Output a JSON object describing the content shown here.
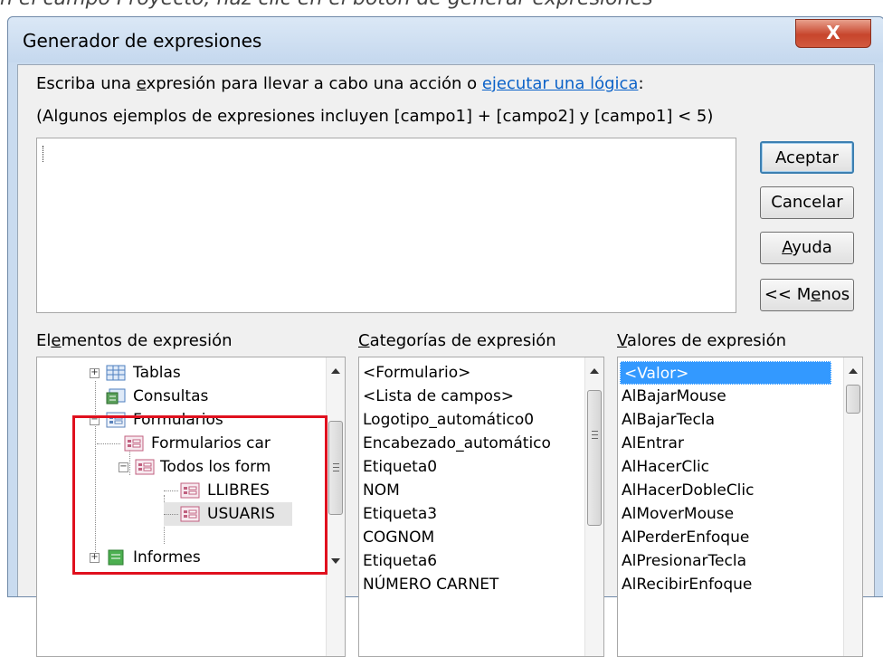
{
  "caption_fragment": "n el campo Proyecto, haz clic en el botón de generar expresiones",
  "window": {
    "title": "Generador de expresiones",
    "close_label": "X"
  },
  "instructions": {
    "line1_prefix": "Escriba una ",
    "line1_underlined": "e",
    "line1_mid": "xpresión para llevar a cabo una acción o ",
    "line1_link": "ejecutar una lógica",
    "line1_suffix": ":",
    "line2": "(Algunos ejemplos de expresiones incluyen [campo1] + [campo2] y [campo1] < 5)"
  },
  "expression_value": "",
  "buttons": {
    "ok": "Aceptar",
    "cancel": "Cancelar",
    "help_underlined": "A",
    "help_rest": "yuda",
    "less_prefix": "<< M",
    "less_underlined": "e",
    "less_rest": "nos"
  },
  "labels": {
    "elements_pre": "El",
    "elements_u": "e",
    "elements_rest": "mentos de expresión",
    "categories_u": "C",
    "categories_rest": "ategorías de expresión",
    "values_u": "V",
    "values_rest": "alores de expresión"
  },
  "elements_tree": [
    {
      "label": "Tablas",
      "icon": "table-icon",
      "expander": "+"
    },
    {
      "label": "Consultas",
      "icon": "query-icon",
      "expander": ""
    },
    {
      "label": "Formularios",
      "icon": "form-icon",
      "expander": "−"
    },
    {
      "label": "Formularios car",
      "icon": "form-icon",
      "expander": ""
    },
    {
      "label": "Todos los form",
      "icon": "form-icon",
      "expander": "−"
    },
    {
      "label": "LLIBRES",
      "icon": "form-icon",
      "expander": ""
    },
    {
      "label": "USUARIS",
      "icon": "form-icon",
      "expander": ""
    },
    {
      "label": "Informes",
      "icon": "report-icon",
      "expander": "+"
    }
  ],
  "categories": [
    "<Formulario>",
    "<Lista de campos>",
    "Logotipo_automático0",
    "Encabezado_automático",
    "Etiqueta0",
    "NOM",
    "Etiqueta3",
    "COGNOM",
    "Etiqueta6",
    "NÚMERO CARNET"
  ],
  "values": [
    "<Valor>",
    "AlBajarMouse",
    "AlBajarTecla",
    "AlEntrar",
    "AlHacerClic",
    "AlHacerDobleClic",
    "AlMoverMouse",
    "AlPerderEnfoque",
    "AlPresionarTecla",
    "AlRecibirEnfoque"
  ],
  "selected_value_index": 0,
  "colors": {
    "highlight_box": "#e0101e",
    "selection": "#3399ff",
    "link": "#0b62c8"
  }
}
